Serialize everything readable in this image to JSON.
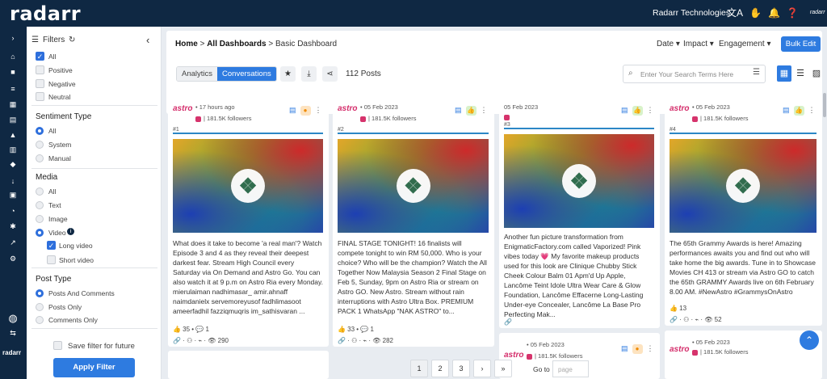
{
  "brand": {
    "logo": "radarr",
    "org": "Radarr Technologies",
    "mini_logo": "radarr",
    "rail_brand": "radarr"
  },
  "filters": {
    "title": "Filters",
    "sentiment_opts": [
      {
        "label": "All",
        "on": true
      },
      {
        "label": "Positive",
        "on": false
      },
      {
        "label": "Negative",
        "on": false
      },
      {
        "label": "Neutral",
        "on": false
      }
    ],
    "sentiment_type": {
      "title": "Sentiment Type",
      "opts": [
        "All",
        "System",
        "Manual"
      ]
    },
    "media": {
      "title": "Media",
      "opts": [
        "All",
        "Text",
        "Image",
        "Video"
      ],
      "long": "Long video",
      "short": "Short video"
    },
    "post_type": {
      "title": "Post Type",
      "opts": [
        "Posts And Comments",
        "Posts Only",
        "Comments Only"
      ]
    },
    "save": "Save filter for future",
    "apply": "Apply Filter"
  },
  "header": {
    "crumb_home": "Home",
    "crumb_sep1": ">",
    "crumb_dash": "All Dashboards",
    "crumb_sep2": ">",
    "crumb_current": "Basic Dashboard",
    "drop_date": "Date ▾",
    "drop_impact": "Impact ▾",
    "drop_engagement": "Engagement ▾",
    "bulk": "Bulk Edit",
    "tab_analytics": "Analytics",
    "tab_conversations": "Conversations",
    "post_count": "112 Posts",
    "search_placeholder": "Enter Your Search Terms Here"
  },
  "cards": [
    {
      "source": "astro",
      "time": "• 17 hours ago",
      "followers": "| 181.5K followers",
      "num": "#1",
      "text": "What does it take to become 'a real man'? Watch Episode 3 and 4 as they reveal their deepest darkest fear. Stream High Council every Saturday via On Demand and Astro Go. You can also watch it at 9 p.m on Astro Ria every Monday. mierulaiman nadhimasar_ amir.ahnaff naimdanielx servemoreyusof fadhlimasoot ameerfadhil fazziqmuqris im_sathisvaran ...",
      "stats": "👍 35 • 💬 1",
      "views": "290"
    },
    {
      "source": "astro",
      "time": "• 05 Feb 2023",
      "followers": "| 181.5K followers",
      "num": "#2",
      "text": "FINAL STAGE TONIGHT! 16 finalists will compete tonight to win RM 50,000. Who is your choice? Who will be the champion? Watch the All Together Now Malaysia Season 2 Final Stage on Feb 5, Sunday, 9pm on Astro Ria or stream on Astro GO. New Astro. Stream without rain interruptions with Astro Ultra Box. PREMIUM PACK 1 WhatsApp \"NAK ASTRO\" to...",
      "stats": "👍 33 • 💬 1",
      "views": "282"
    },
    {
      "source": "",
      "time": "05 Feb 2023",
      "followers": "",
      "num": "#3",
      "text": "Another fun picture transformation from EnigmaticFactory.com called Vaporized! Pink vibes today 💗 My favorite makeup products used for this look are Clinique Chubby Stick Cheek Colour Balm 01 Apm'd Up Apple, Lancôme Teint Idole Ultra Wear Care & Glow Foundation, Lancôme Effacerne Long-Lasting Under-eye Concealer, Lancôme La Base Pro Perfecting Mak...",
      "stats": "",
      "views": ""
    },
    {
      "source": "astro",
      "time": "• 05 Feb 2023",
      "followers": "| 181.5K followers",
      "num": "#4",
      "text": "The 65th Grammy Awards is here! Amazing performances awaits you and find out who will take home the big awards. Tune in to Showcase Movies CH 413 or stream via Astro GO to catch the 65th GRAMMY Awards live on 6th February 8.00 AM. #NewAstro #GrammysOnAstro",
      "stats": "👍 13",
      "views": "52"
    }
  ],
  "pager": {
    "p1": "1",
    "p2": "2",
    "p3": "3",
    "next": "›",
    "last": "»",
    "goto": "Go to",
    "goto_ph": "page"
  },
  "lower_cards": [
    {
      "source": "astro",
      "time": "• 05 Feb 2023",
      "followers": "| 181.5K followers"
    },
    {
      "source": "astro",
      "time": "• 05 Feb 2023",
      "followers": "| 181.5K followers"
    }
  ]
}
